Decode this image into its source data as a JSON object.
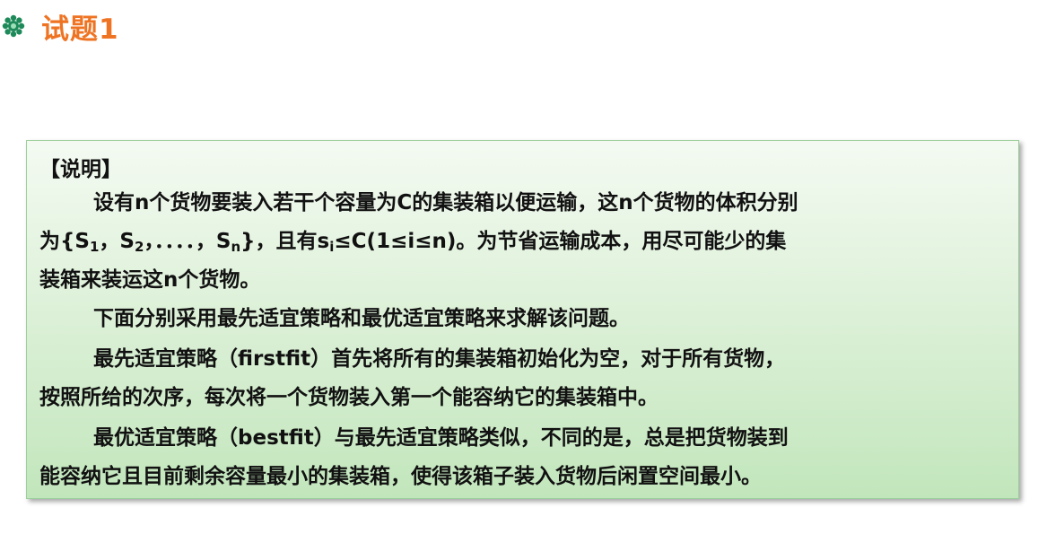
{
  "title": "试题1",
  "note": {
    "heading": "【说明】",
    "para1_line1": "设有n个货物要装入若干个容量为C的集装箱以便运输，这n个货物的体积分别",
    "para1_line2_prefix": "为{S",
    "s1_sub": "1",
    "sep1": "，S",
    "s2_sub": "2",
    "sep2": "，．．．．，S",
    "sn_sub": "n",
    "line2_mid": "}，且有s",
    "si_sub": "i",
    "line2_suffix": "≤C(1≤i≤n)。为节省运输成本，用尽可能少的集",
    "para1_line3": "装箱来装运这n个货物。",
    "para2": "下面分别采用最先适宜策略和最优适宜策略来求解该问题。",
    "para3_line1": "最先适宜策略（firstfit）首先将所有的集装箱初始化为空，对于所有货物，",
    "para3_line2": "按照所给的次序，每次将一个货物装入第一个能容纳它的集装箱中。",
    "para4_line1": "最优适宜策略（bestfit）与最先适宜策略类似，不同的是，总是把货物装到",
    "para4_line2": "能容纳它且目前剩余容量最小的集装箱，使得该箱子装入货物后闲置空间最小。"
  },
  "colors": {
    "title": "#ee7423",
    "icon": "#1e8a5a",
    "box_border": "#9ccf9b",
    "box_bg_top": "#f4faf2",
    "box_bg_bottom": "#c2e6bc"
  },
  "icons": {
    "title_icon": "green-flower-bullet-icon"
  }
}
